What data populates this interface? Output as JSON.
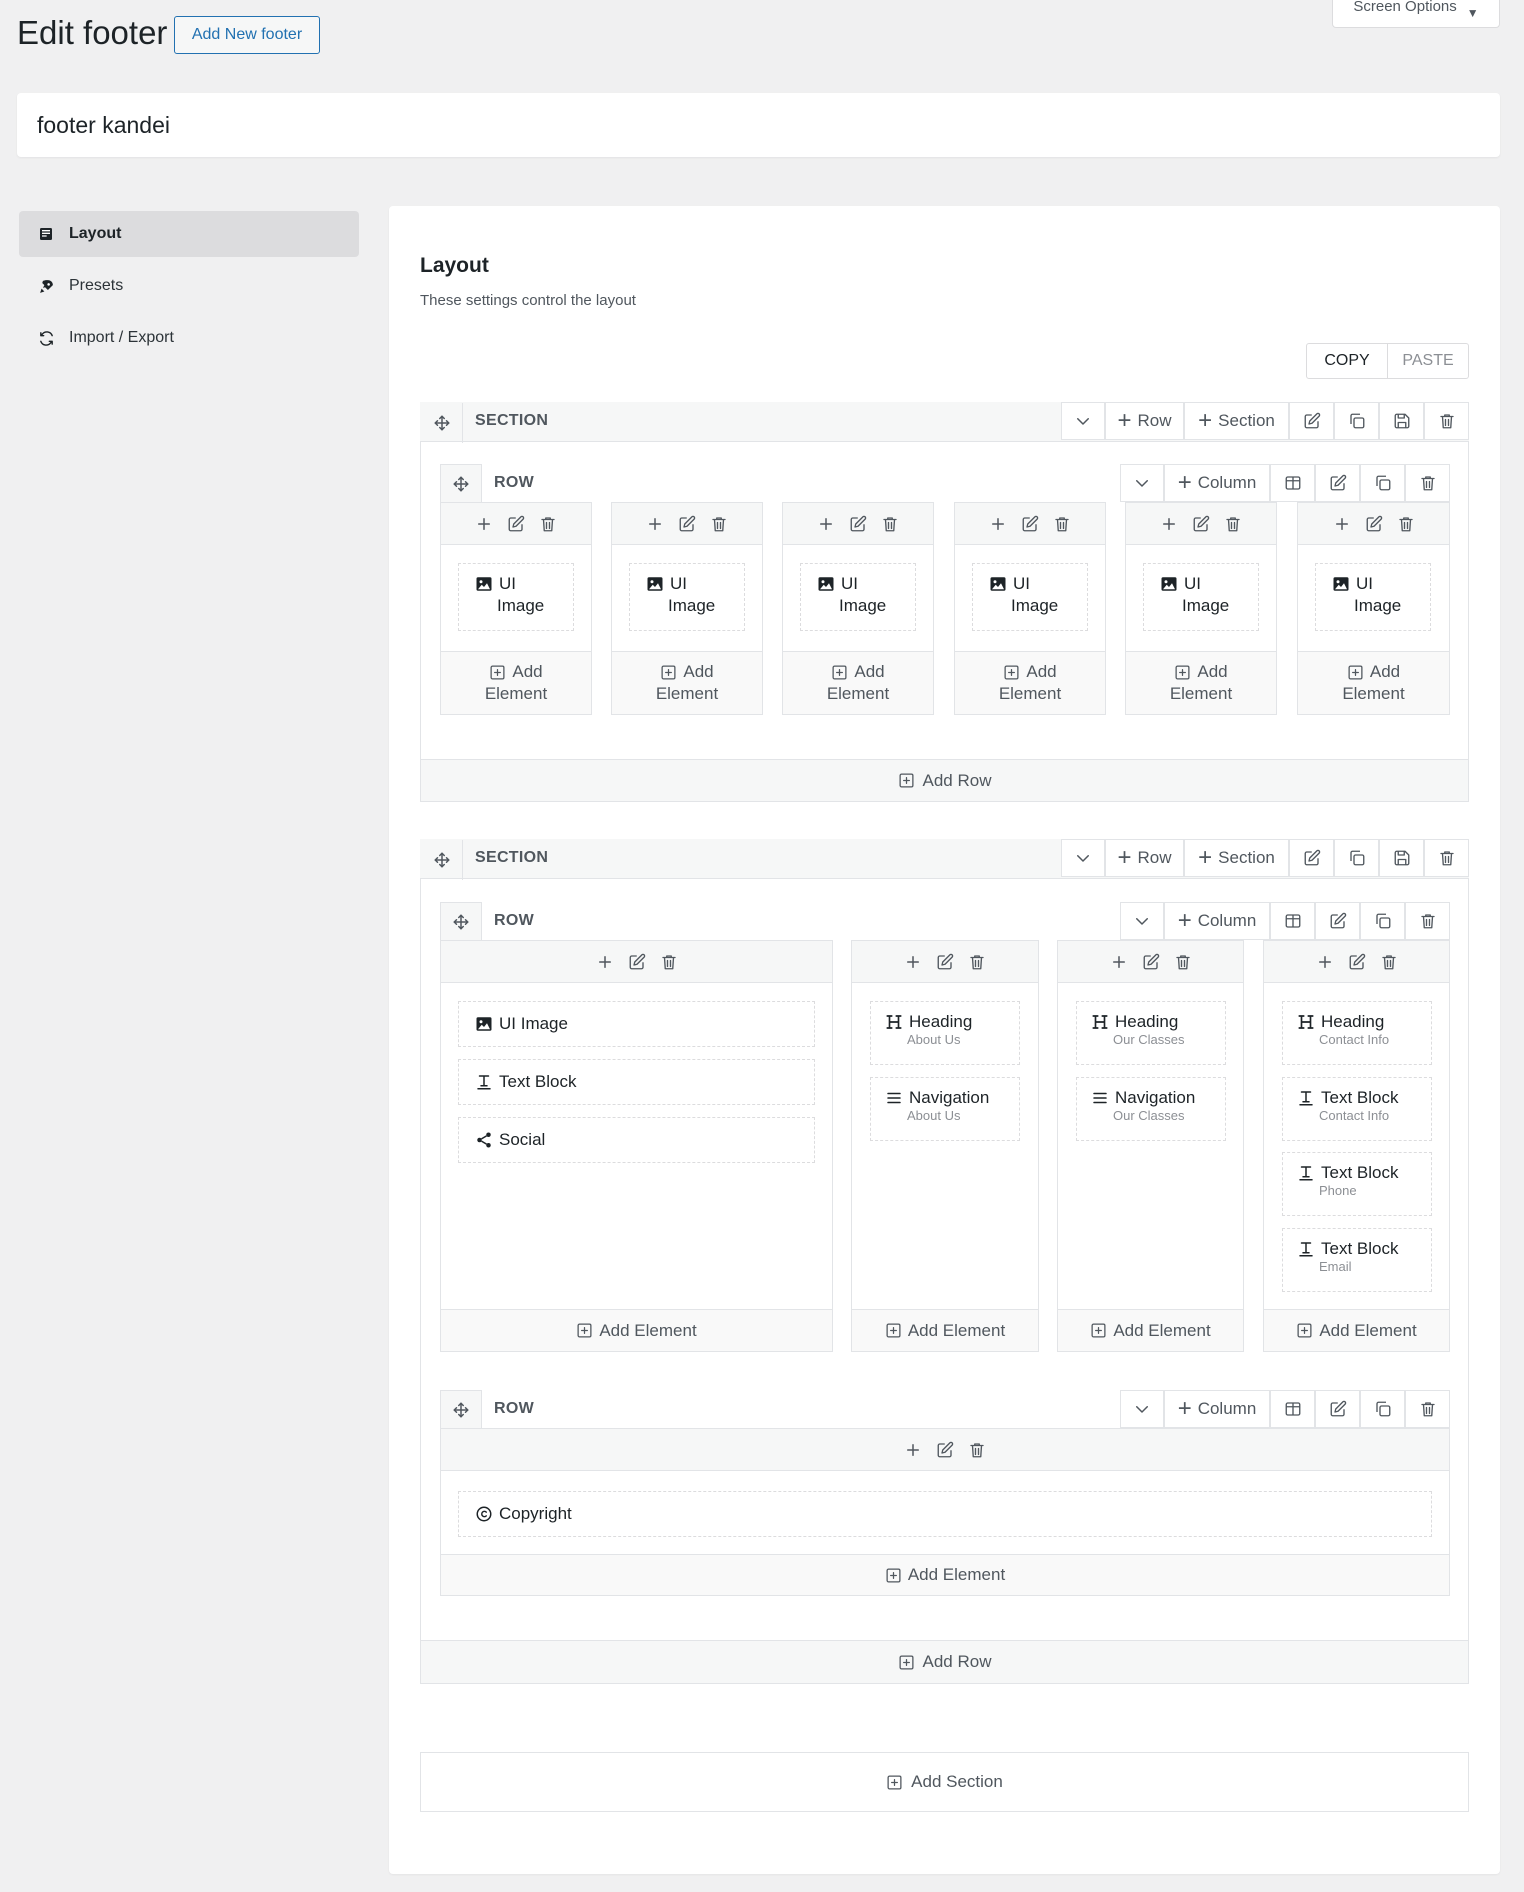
{
  "header": {
    "title": "Edit footer",
    "add_new": "Add New footer",
    "screen_options": "Screen Options"
  },
  "post_title": "footer kandei",
  "tabs": [
    {
      "label": "Layout",
      "icon": "layout-icon"
    },
    {
      "label": "Presets",
      "icon": "rocket-icon"
    },
    {
      "label": "Import / Export",
      "icon": "refresh-icon"
    }
  ],
  "panel": {
    "title": "Layout",
    "description": "These settings control the layout",
    "copy": "COPY",
    "paste": "PASTE"
  },
  "builder": {
    "section_label": "SECTION",
    "row_label": "ROW",
    "add_row_btn": "Row",
    "add_section_btn": "Section",
    "add_column_btn": "Column",
    "add_element": "Add Element",
    "add_element_l1": "Add",
    "add_element_l2": "Element",
    "add_row_bar": "Add Row",
    "add_section_bar": "Add Section"
  },
  "section1": {
    "ui_image_l1": "UI",
    "ui_image_l2": "Image"
  },
  "section2": {
    "col1": [
      "UI Image",
      "Text Block",
      "Social"
    ],
    "col2": [
      {
        "label": "Heading",
        "sub": "About Us"
      },
      {
        "label": "Navigation",
        "sub": "About Us"
      }
    ],
    "col3": [
      {
        "label": "Heading",
        "sub": "Our Classes"
      },
      {
        "label": "Navigation",
        "sub": "Our Classes"
      }
    ],
    "col4": [
      {
        "label": "Heading",
        "sub": "Contact Info"
      },
      {
        "label": "Text Block",
        "sub": "Contact Info"
      },
      {
        "label": "Text Block",
        "sub": "Phone"
      },
      {
        "label": "Text Block",
        "sub": "Email"
      }
    ],
    "copyright": "Copyright"
  },
  "colors": {
    "accent": "#2271b1",
    "border": "#e2e4e7",
    "icon": "#50575e"
  }
}
